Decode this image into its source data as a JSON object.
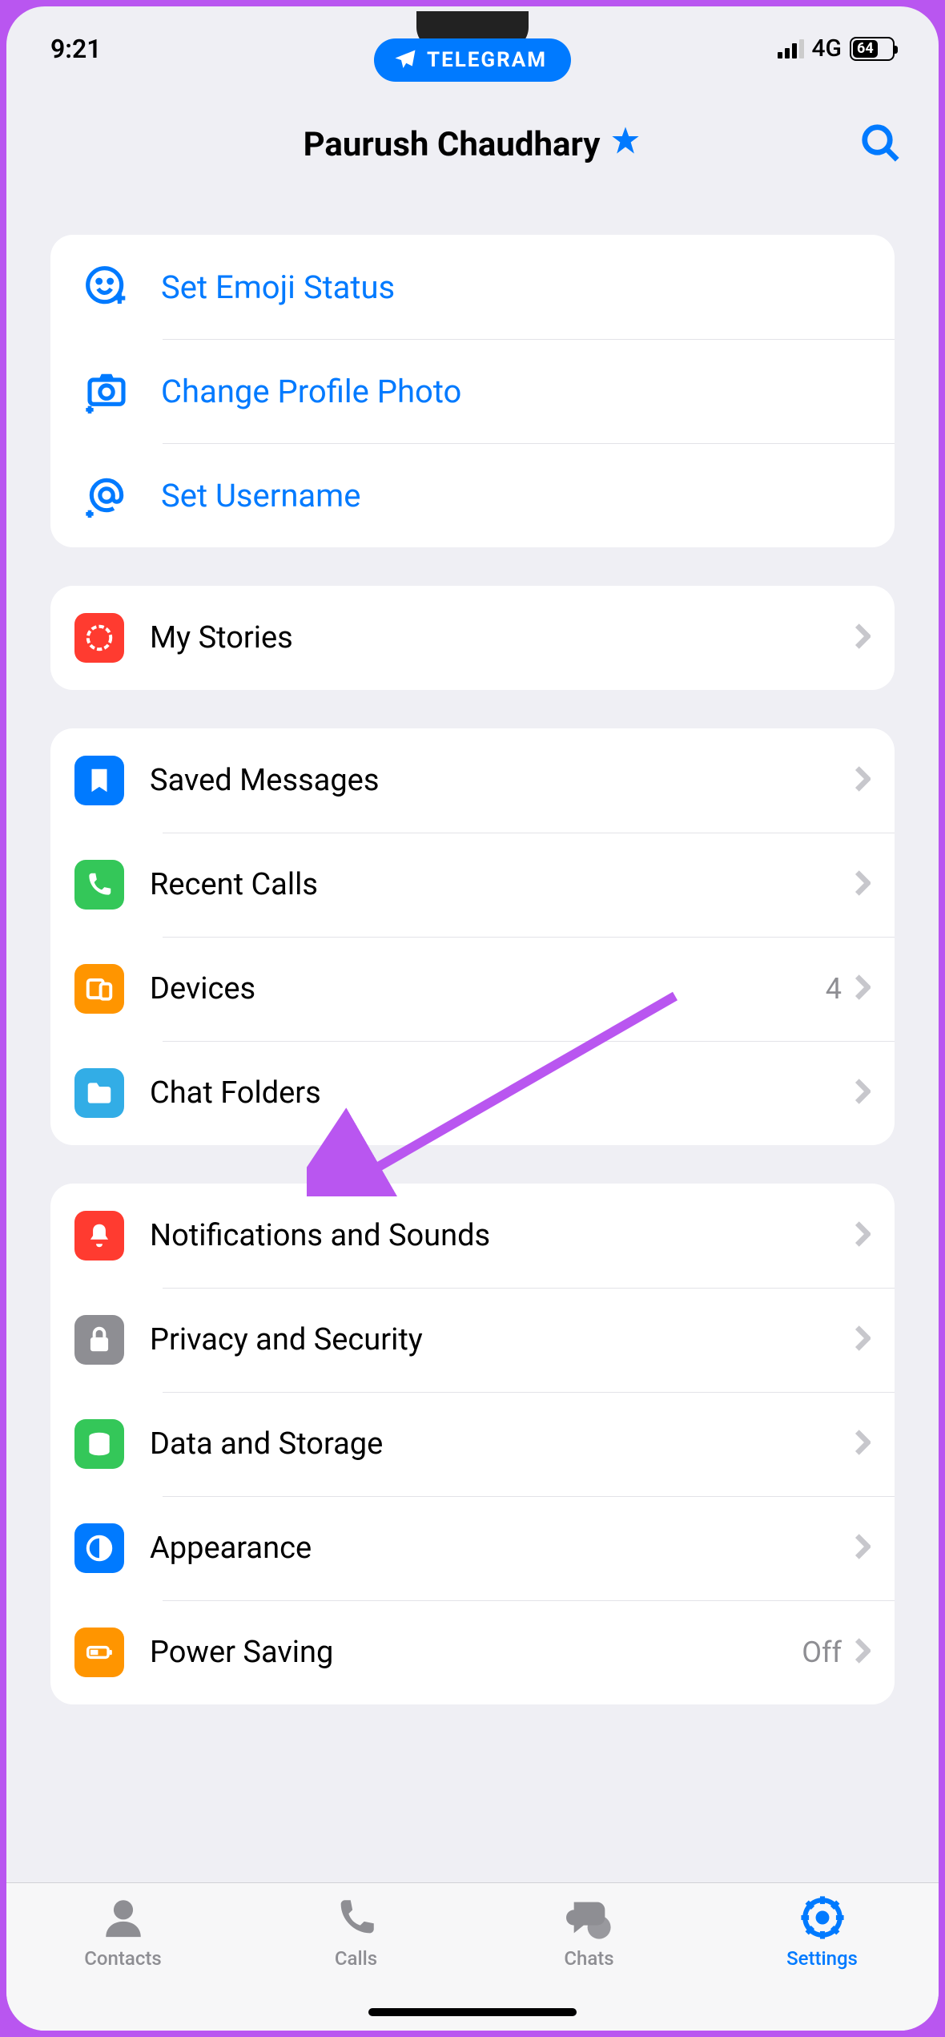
{
  "status": {
    "time": "9:21",
    "network": "4G",
    "battery": "64"
  },
  "pill": {
    "app": "TELEGRAM"
  },
  "header": {
    "title": "Paurush Chaudhary"
  },
  "group1": {
    "emoji_status": "Set Emoji Status",
    "change_photo": "Change Profile Photo",
    "set_username": "Set Username"
  },
  "group2": {
    "my_stories": "My Stories"
  },
  "group3": {
    "saved_messages": "Saved Messages",
    "recent_calls": "Recent Calls",
    "devices": "Devices",
    "devices_count": "4",
    "chat_folders": "Chat Folders"
  },
  "group4": {
    "notifications": "Notifications and Sounds",
    "privacy": "Privacy and Security",
    "data": "Data and Storage",
    "appearance": "Appearance",
    "power_saving": "Power Saving",
    "power_saving_value": "Off"
  },
  "tabs": {
    "contacts": "Contacts",
    "calls": "Calls",
    "chats": "Chats",
    "settings": "Settings"
  }
}
